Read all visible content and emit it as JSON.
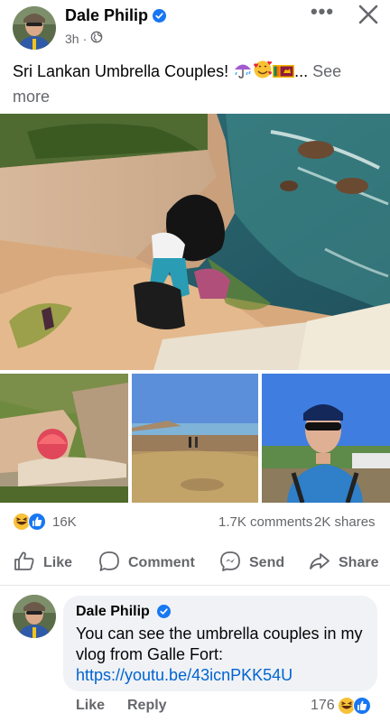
{
  "post": {
    "author": "Dale Philip",
    "time": "3h",
    "time_separator": "·",
    "privacy_icon": "globe-icon",
    "text": "Sri Lankan Umbrella Couples! ",
    "ellipsis": "...",
    "see_more": "See more",
    "emojis": [
      "umbrella-with-rain",
      "smiling-face-with-hearts",
      "sri-lanka-flag"
    ]
  },
  "header": {
    "more_label": "•••",
    "close_icon": "close-icon"
  },
  "stats": {
    "reactions": "16K",
    "comments": "1.7K comments",
    "shares": "2K shares"
  },
  "actions": {
    "like": "Like",
    "comment": "Comment",
    "send": "Send",
    "share": "Share"
  },
  "comment": {
    "author": "Dale Philip",
    "text": "You can see the umbrella couples in my vlog from Galle Fort:",
    "link": "https://youtu.be/43icnPKK54U",
    "like": "Like",
    "reply": "Reply",
    "reactions": "176"
  },
  "colors": {
    "verified": "#1877f2",
    "secondary_text": "#65676b",
    "link": "#0064d1",
    "bubble": "#f0f2f5"
  }
}
